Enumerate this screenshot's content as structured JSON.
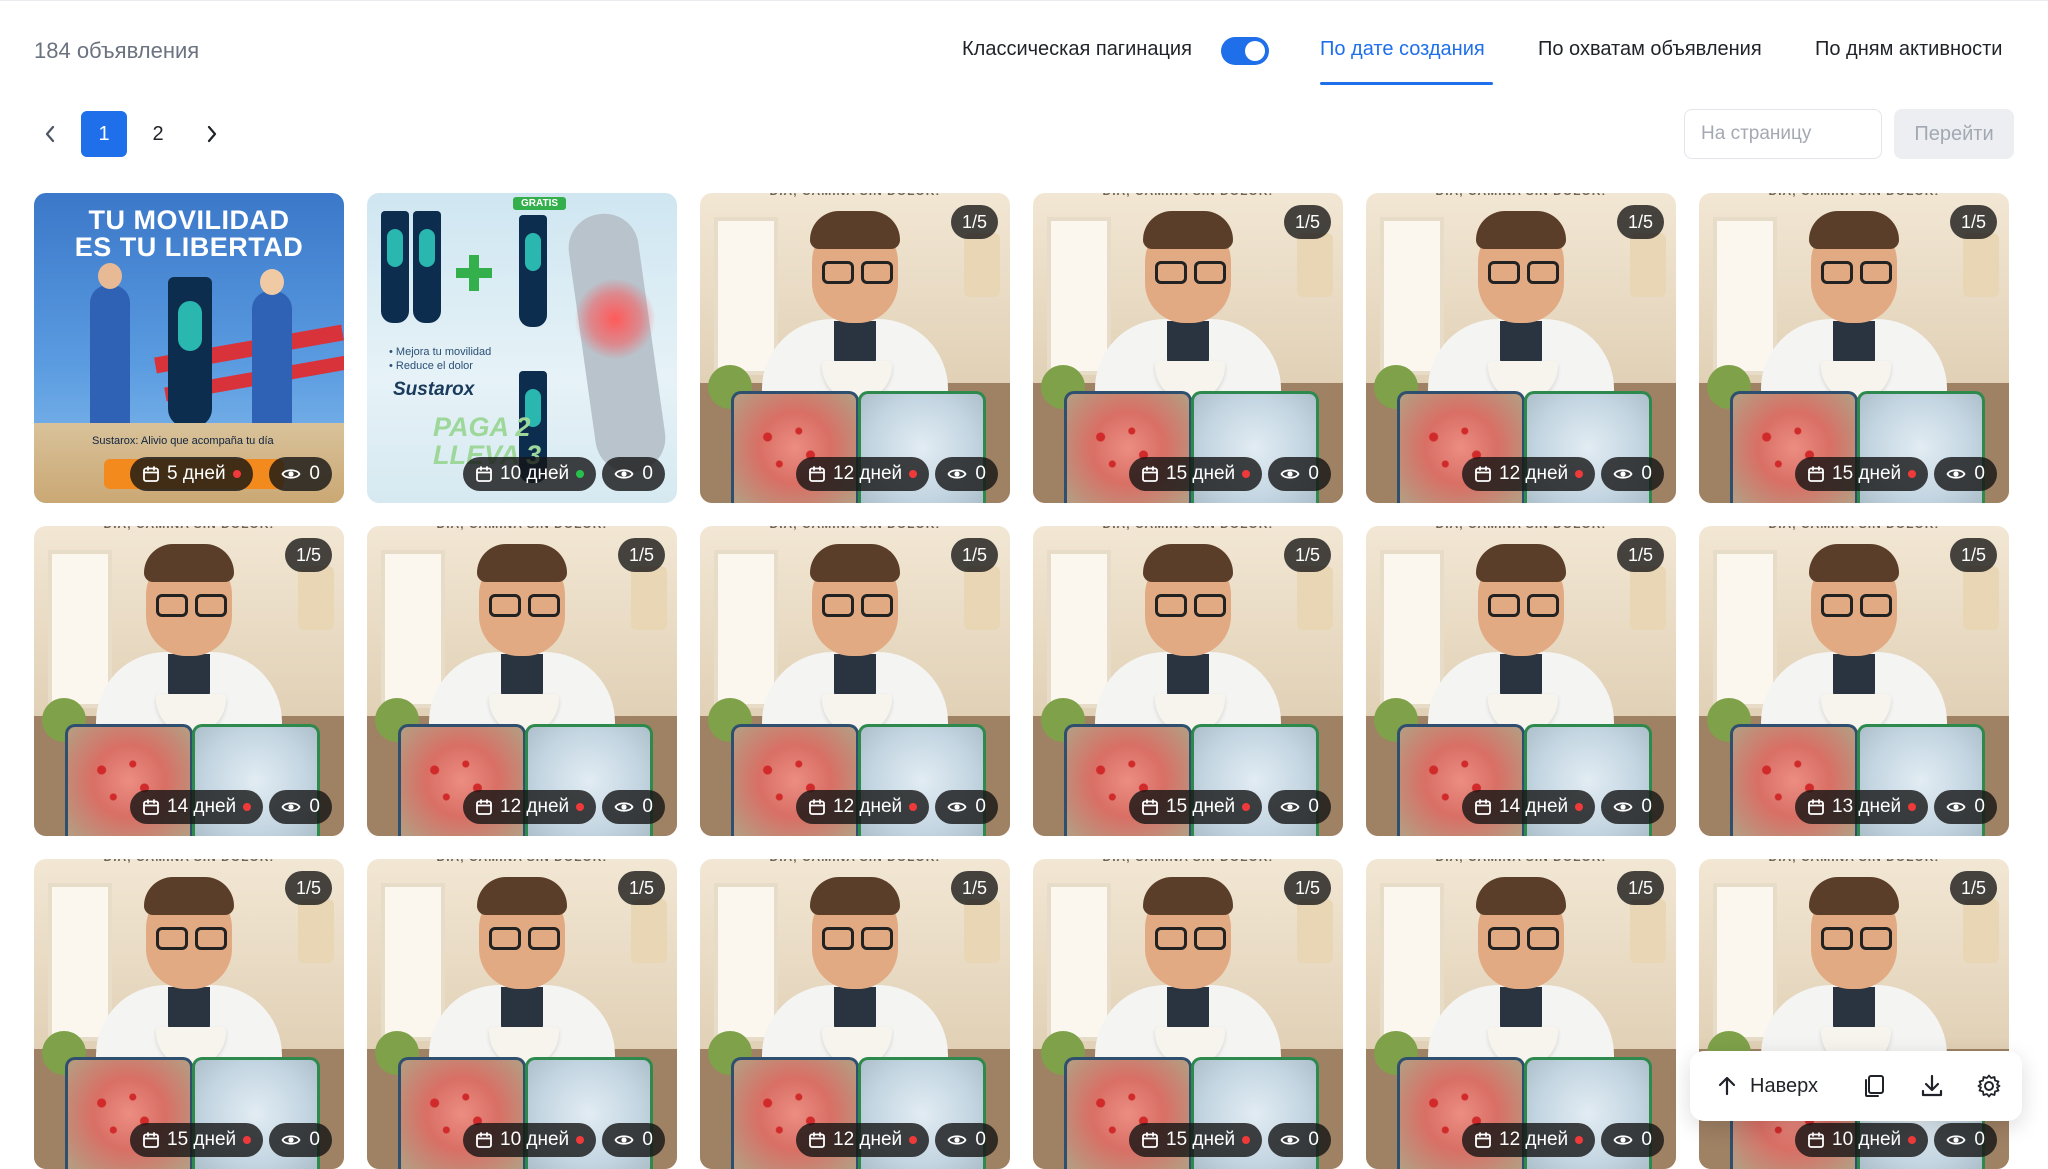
{
  "header": {
    "count_text": "184 объявления",
    "pagination_toggle_label": "Классическая пагинация",
    "pagination_toggle_on": true,
    "sort_tabs": [
      {
        "label": "По дате создания",
        "active": true
      },
      {
        "label": "По охватам объявления",
        "active": false
      },
      {
        "label": "По дням активности",
        "active": false
      }
    ]
  },
  "pagination": {
    "pages": [
      "1",
      "2"
    ],
    "current_page": "1",
    "jump_placeholder": "На страницу",
    "jump_button": "Перейти"
  },
  "cards": [
    {
      "image": "ad-a",
      "counter": "",
      "days": "5 дней",
      "status": "red",
      "views": "0"
    },
    {
      "image": "ad-b",
      "counter": "",
      "days": "10 дней",
      "status": "green",
      "views": "0"
    },
    {
      "image": "doctor",
      "counter": "1/5",
      "days": "12 дней",
      "status": "red",
      "views": "0"
    },
    {
      "image": "doctor",
      "counter": "1/5",
      "days": "15 дней",
      "status": "red",
      "views": "0"
    },
    {
      "image": "doctor",
      "counter": "1/5",
      "days": "12 дней",
      "status": "red",
      "views": "0"
    },
    {
      "image": "doctor",
      "counter": "1/5",
      "days": "15 дней",
      "status": "red",
      "views": "0"
    },
    {
      "image": "doctor",
      "counter": "1/5",
      "days": "14 дней",
      "status": "red",
      "views": "0"
    },
    {
      "image": "doctor",
      "counter": "1/5",
      "days": "12 дней",
      "status": "red",
      "views": "0"
    },
    {
      "image": "doctor",
      "counter": "1/5",
      "days": "12 дней",
      "status": "red",
      "views": "0"
    },
    {
      "image": "doctor",
      "counter": "1/5",
      "days": "15 дней",
      "status": "red",
      "views": "0"
    },
    {
      "image": "doctor",
      "counter": "1/5",
      "days": "14 дней",
      "status": "red",
      "views": "0"
    },
    {
      "image": "doctor",
      "counter": "1/5",
      "days": "13 дней",
      "status": "red",
      "views": "0"
    },
    {
      "image": "doctor",
      "counter": "1/5",
      "days": "15 дней",
      "status": "red",
      "views": "0"
    },
    {
      "image": "doctor",
      "counter": "1/5",
      "days": "10 дней",
      "status": "red",
      "views": "0"
    },
    {
      "image": "doctor",
      "counter": "1/5",
      "days": "12 дней",
      "status": "red",
      "views": "0"
    },
    {
      "image": "doctor",
      "counter": "1/5",
      "days": "15 дней",
      "status": "red",
      "views": "0"
    },
    {
      "image": "doctor",
      "counter": "1/5",
      "days": "12 дней",
      "status": "red",
      "views": "0"
    },
    {
      "image": "doctor",
      "counter": "1/5",
      "days": "10 дней",
      "status": "red",
      "views": "0"
    }
  ],
  "ad_images": {
    "ad_a": {
      "headline_line1": "TU MOVILIDAD",
      "headline_line2": "ES TU LIBERTAD",
      "caption": "Sustarox: Alivio que acompaña tu día"
    },
    "ad_b": {
      "gratis": "GRATIS",
      "bullet1": "• Mejora tu movilidad",
      "bullet2": "• Reduce el dolor",
      "brand": "Sustarox",
      "promo_line1": "PAGA 2",
      "promo_line2": "LLEVA 3"
    },
    "doctor_top_text": "DÍA, CAMINA SIN DOLOR!"
  },
  "floating_bar": {
    "up_label": "Наверх",
    "icons": [
      "arrow-up-icon",
      "copy-icon",
      "download-icon",
      "gear-icon"
    ]
  },
  "colors": {
    "accent": "#1f6feb",
    "status_red": "#f03a3a",
    "status_green": "#27c24c"
  }
}
